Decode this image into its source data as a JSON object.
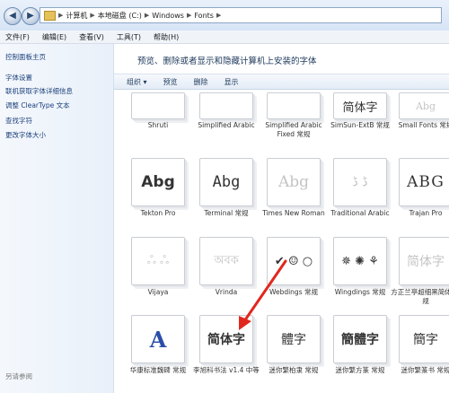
{
  "address": {
    "back_icon": "back-arrow-icon",
    "forward_icon": "forward-arrow-icon",
    "crumbs": [
      "计算机",
      "本地磁盘 (C:)",
      "Windows",
      "Fonts"
    ]
  },
  "menu": [
    "文件(F)",
    "编辑(E)",
    "查看(V)",
    "工具(T)",
    "帮助(H)"
  ],
  "sidebar": {
    "links": [
      "控制面板主页",
      "字体设置",
      "联机获取字体详细信息",
      "调整 ClearType 文本",
      "查找字符",
      "更改字体大小"
    ],
    "see_also": "另请参阅"
  },
  "main": {
    "title": "预览、删除或者显示和隐藏计算机上安装的字体",
    "toolbar": [
      "组织 ▾",
      "预览",
      "删除",
      "显示"
    ]
  },
  "fonts": [
    {
      "name": "Shruti",
      "sample": "",
      "light": true
    },
    {
      "name": "Simplified Arabic",
      "sample": "",
      "light": true
    },
    {
      "name": "Simplified Arabic Fixed 常规",
      "sample": "",
      "light": true
    },
    {
      "name": "SimSun-ExtB 常规",
      "sample": "简体字",
      "light": false
    },
    {
      "name": "Small Fonts 常规",
      "sample": "Abg",
      "light": true
    },
    {
      "name": "Tekton Pro",
      "sample": "Abg",
      "light": false
    },
    {
      "name": "Terminal 常规",
      "sample": "Abg",
      "light": false
    },
    {
      "name": "Times New Roman",
      "sample": "Abg",
      "light": true
    },
    {
      "name": "Traditional Arabic",
      "sample": "ڈ ڈ",
      "light": true
    },
    {
      "name": "Trajan Pro",
      "sample": "ABG",
      "light": false
    },
    {
      "name": "Vijaya",
      "sample": "ஃ ஃ",
      "light": true
    },
    {
      "name": "Vrinda",
      "sample": "অবক",
      "light": true
    },
    {
      "name": "Webdings 常规",
      "sample": "✔ ☺ ○",
      "light": false
    },
    {
      "name": "Wingdings 常规",
      "sample": "✵ ✺ ⚘",
      "light": false
    },
    {
      "name": "方正兰亭超细黑简体 常规",
      "sample": "简体字",
      "light": true
    },
    {
      "name": "华康标准魏碑 常规",
      "sample": "A",
      "light": false
    },
    {
      "name": "李旭科书法 v1.4 中等",
      "sample": "简体字",
      "light": false
    },
    {
      "name": "迷你繁柏隶 常规",
      "sample": "體字",
      "light": false
    },
    {
      "name": "迷你繁方篆 常规",
      "sample": "簡體字",
      "light": false
    },
    {
      "name": "迷你繁篆书 常规",
      "sample": "簡字",
      "light": false
    }
  ]
}
